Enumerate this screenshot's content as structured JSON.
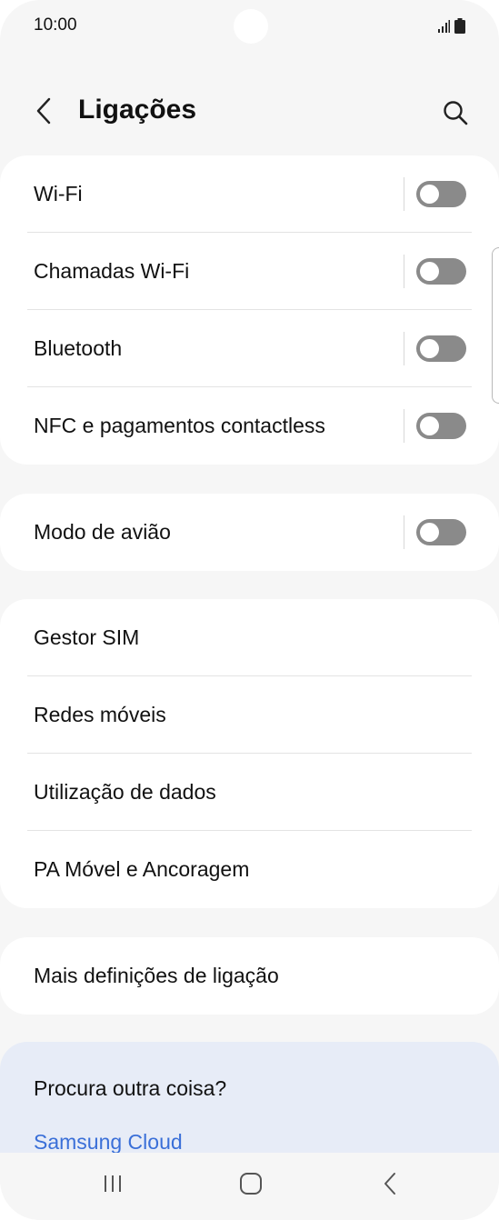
{
  "status_bar": {
    "time": "10:00",
    "icons": [
      "signal-icon",
      "battery-icon"
    ]
  },
  "header": {
    "title": "Ligações",
    "back_icon": "chevron-left-icon",
    "search_icon": "search-icon"
  },
  "groups": [
    {
      "items": [
        {
          "label": "Wi-Fi",
          "toggle": false
        },
        {
          "label": "Chamadas Wi-Fi",
          "toggle": false
        },
        {
          "label": "Bluetooth",
          "toggle": false
        },
        {
          "label": "NFC e pagamentos contactless",
          "toggle": false
        }
      ]
    },
    {
      "items": [
        {
          "label": "Modo de avião",
          "toggle": false
        }
      ]
    },
    {
      "items": [
        {
          "label": "Gestor SIM"
        },
        {
          "label": "Redes móveis"
        },
        {
          "label": "Utilização de dados"
        },
        {
          "label": "PA Móvel e Ancoragem"
        }
      ]
    },
    {
      "items": [
        {
          "label": "Mais definições de ligação"
        }
      ]
    }
  ],
  "search_suggestions": {
    "title": "Procura outra coisa?",
    "link": "Samsung Cloud"
  },
  "nav_bar": {
    "icons": [
      "recent-apps-icon",
      "home-icon",
      "back-icon"
    ]
  },
  "colors": {
    "background": "#f6f6f6",
    "card": "#ffffff",
    "toggle_off": "#8a8a8a",
    "suggestion_card": "#e7ecf7",
    "link": "#3a6fd8"
  }
}
